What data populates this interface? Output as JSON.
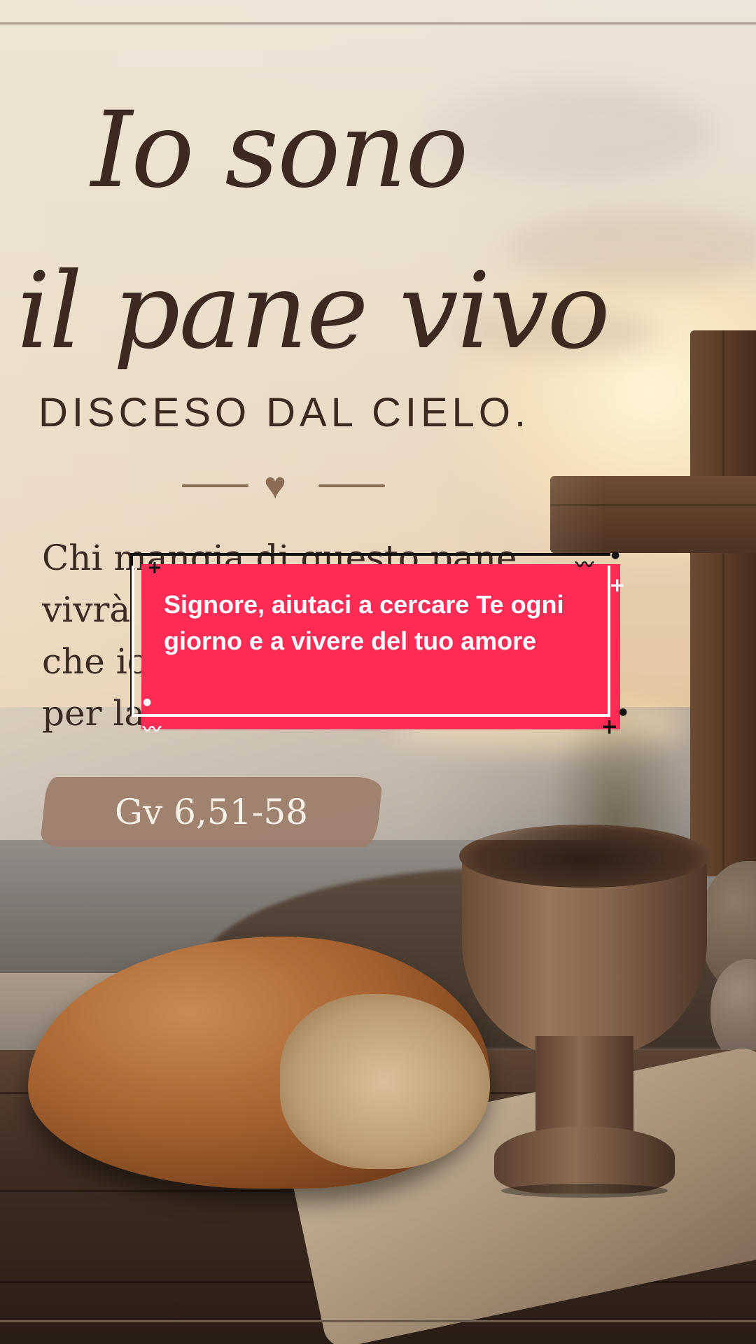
{
  "poster": {
    "title_line1": "Io sono",
    "title_line2": "il pane vivo",
    "subtitle": "DISCESO DAL CIELO.",
    "divider_icon": "heart-icon",
    "quote_lines": [
      "Chi mangia di questo pane",
      "vivrà i",
      "che io",
      "per la"
    ],
    "reference": "Gv 6,51-58"
  },
  "caption": {
    "text": "Signore, aiutaci a cercare Te ogni giorno e a vivere del tuo amore",
    "accent_color": "#fe2c55"
  }
}
